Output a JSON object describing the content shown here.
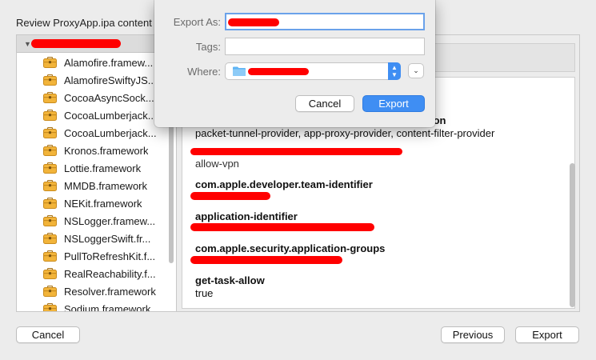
{
  "window": {
    "review_title": "Review ProxyApp.ipa content"
  },
  "tree": {
    "items": [
      {
        "label": "Alamofire.framew..."
      },
      {
        "label": "AlamofireSwiftyJS..."
      },
      {
        "label": "CocoaAsyncSock..."
      },
      {
        "label": "CocoaLumberjack..."
      },
      {
        "label": "CocoaLumberjack..."
      },
      {
        "label": "Kronos.framework"
      },
      {
        "label": "Lottie.framework"
      },
      {
        "label": "MMDB.framework"
      },
      {
        "label": "NEKit.framework"
      },
      {
        "label": "NSLogger.framew..."
      },
      {
        "label": "NSLoggerSwift.fr..."
      },
      {
        "label": "PullToRefreshKit.f..."
      },
      {
        "label": "RealReachability.f..."
      },
      {
        "label": "Resolver.framework"
      },
      {
        "label": "Sodium.framework"
      }
    ],
    "icon": "framework-bag-icon"
  },
  "entitlements": {
    "partial_key_suffix": "ion",
    "network_extension_values": "packet-tunnel-provider, app-proxy-provider, content-filter-provider",
    "vpn_value": "allow-vpn",
    "team_identifier_key": "com.apple.developer.team-identifier",
    "application_identifier_key": "application-identifier",
    "application_groups_key": "com.apple.security.application-groups",
    "get_task_allow_key": "get-task-allow",
    "get_task_allow_value": "true"
  },
  "buttons": {
    "cancel": "Cancel",
    "previous": "Previous",
    "export": "Export"
  },
  "export_sheet": {
    "export_as_label": "Export As:",
    "tags_label": "Tags:",
    "where_label": "Where:",
    "cancel": "Cancel",
    "export": "Export"
  },
  "colors": {
    "accent": "#3f8ef3",
    "redaction": "#ff0000"
  }
}
